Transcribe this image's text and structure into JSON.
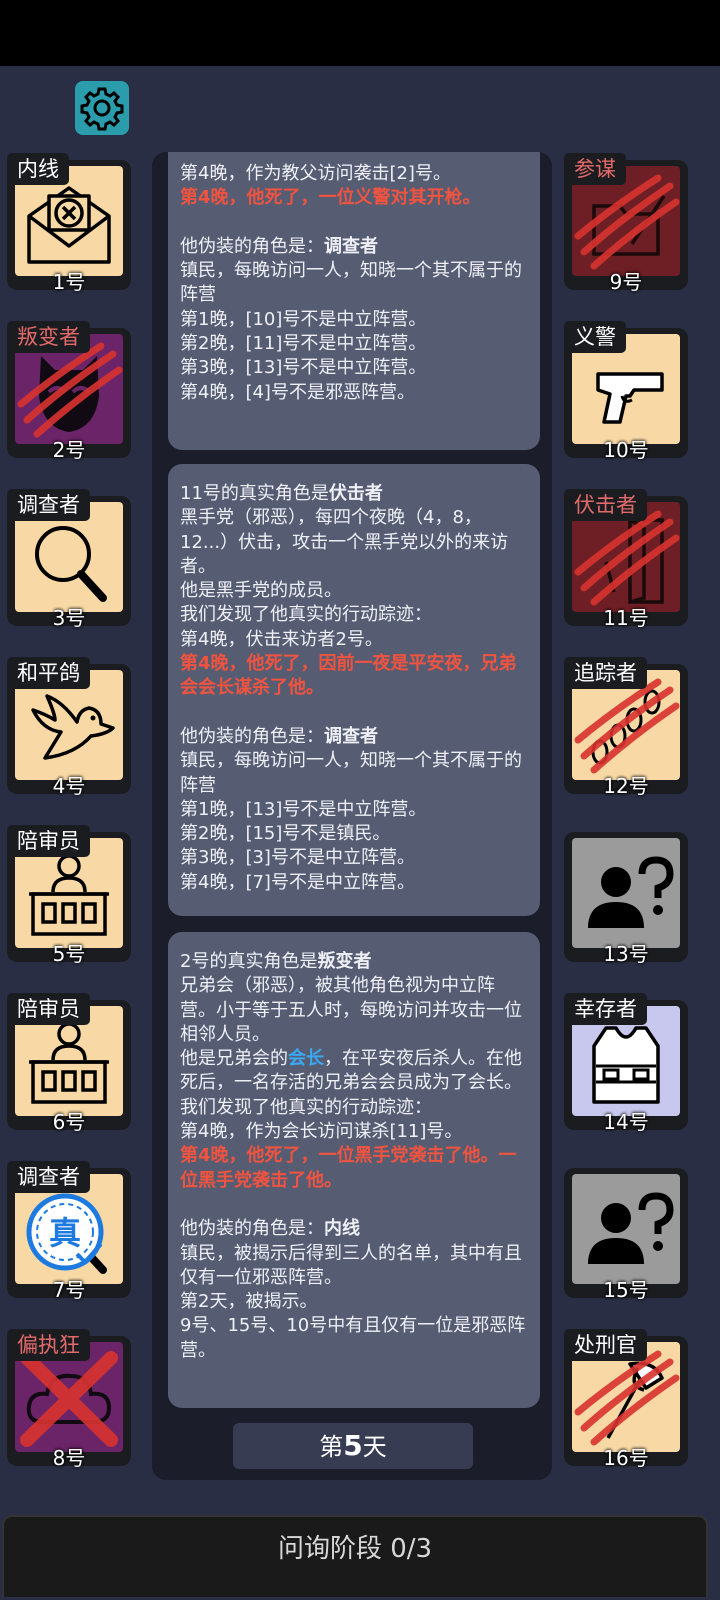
{
  "icons": {
    "settings": "gear-icon"
  },
  "players_left": [
    {
      "role": "内线",
      "num": "1号",
      "red": false,
      "face": "cream",
      "icon": "envelope-x-icon",
      "clawed": false
    },
    {
      "role": "叛变者",
      "num": "2号",
      "red": true,
      "face": "purple",
      "icon": "cat-mask-icon",
      "clawed": true
    },
    {
      "role": "调查者",
      "num": "3号",
      "red": false,
      "face": "cream",
      "icon": "magnifier-icon",
      "clawed": false
    },
    {
      "role": "和平鸽",
      "num": "4号",
      "red": false,
      "face": "cream",
      "icon": "dove-icon",
      "clawed": false
    },
    {
      "role": "陪审员",
      "num": "5号",
      "red": false,
      "face": "cream",
      "icon": "juror-icon",
      "clawed": false
    },
    {
      "role": "陪审员",
      "num": "6号",
      "red": false,
      "face": "cream",
      "icon": "juror-icon",
      "clawed": false
    },
    {
      "role": "调查者",
      "num": "7号",
      "red": false,
      "face": "cream",
      "icon": "true-seal-icon",
      "clawed": false,
      "seal_text": "真"
    },
    {
      "role": "偏执狂",
      "num": "8号",
      "red": true,
      "face": "purple",
      "icon": "crossed-out-icon",
      "clawed": false
    }
  ],
  "players_right": [
    {
      "role": "参谋",
      "num": "9号",
      "red": true,
      "face": "maroon",
      "icon": "folder-pen-icon",
      "clawed": true
    },
    {
      "role": "义警",
      "num": "10号",
      "red": false,
      "face": "cream",
      "icon": "pistol-icon",
      "clawed": false
    },
    {
      "role": "伏击者",
      "num": "11号",
      "red": true,
      "face": "maroon",
      "icon": "door-knife-icon",
      "clawed": true
    },
    {
      "role": "追踪者",
      "num": "12号",
      "red": false,
      "face": "cream",
      "icon": "footprints-icon",
      "clawed": true
    },
    {
      "role": "",
      "num": "13号",
      "red": false,
      "face": "grey",
      "icon": "unknown-person-icon",
      "clawed": false
    },
    {
      "role": "幸存者",
      "num": "14号",
      "red": false,
      "face": "lav",
      "icon": "vest-icon",
      "clawed": false
    },
    {
      "role": "",
      "num": "15号",
      "red": false,
      "face": "grey",
      "icon": "unknown-person-icon",
      "clawed": false
    },
    {
      "role": "处刑官",
      "num": "16号",
      "red": false,
      "face": "cream",
      "icon": "axe-icon",
      "clawed": true
    }
  ],
  "messages": {
    "m1": {
      "l1": "第4晚，作为教父访问袭击[2]号。",
      "l2": "第4晚，他死了，一位义警对其开枪。",
      "l3": "他伪装的角色是：",
      "l3b": "调查者",
      "l4": "镇民，每晚访问一人，知晓一个其不属于的阵营",
      "l5": "第1晚，[10]号不是中立阵营。",
      "l6": "第2晚，[11]号不是中立阵营。",
      "l7": "第3晚，[13]号不是中立阵营。",
      "l8": "第4晚，[4]号不是邪恶阵营。"
    },
    "m2": {
      "l1": "11号的真实角色是",
      "l1b": "伏击者",
      "l2": "黑手党（邪恶），每四个夜晚（4，8，12...）伏击，攻击一个黑手党以外的来访者。",
      "l3": "他是黑手党的成员。",
      "l4": "我们发现了他真实的行动踪迹：",
      "l5": "第4晚，伏击来访者2号。",
      "l6": "第4晚，他死了，因前一夜是平安夜，兄弟会会长谋杀了他。",
      "l7": "他伪装的角色是：",
      "l7b": "调查者",
      "l8": "镇民，每晚访问一人，知晓一个其不属于的阵营",
      "l9": "第1晚，[13]号不是中立阵营。",
      "l10": "第2晚，[15]号不是镇民。",
      "l11": "第3晚，[3]号不是中立阵营。",
      "l12": "第4晚，[7]号不是中立阵营。"
    },
    "m3": {
      "l1": "2号的真实角色是",
      "l1b": "叛变者",
      "l2": "兄弟会（邪恶），被其他角色视为中立阵营。小于等于五人时，每晚访问并攻击一位相邻人员。",
      "l3": "他是兄弟会的",
      "l3b": "会长",
      "l3c": "，在平安夜后杀人。在他死后，一名存活的兄弟会会员成为了会长。",
      "l4": "我们发现了他真实的行动踪迹：",
      "l5": "第4晚，作为会长访问谋杀[11]号。",
      "l6": "第4晚，他死了，一位黑手党袭击了他。一位黑手党袭击了他。",
      "l7": "他伪装的角色是：",
      "l7b": "内线",
      "l8": "镇民，被揭示后得到三人的名单，其中有且仅有一位邪恶阵营。",
      "l9": "第2天，被揭示。",
      "l10": "9号、15号、10号中有且仅有一位是邪恶阵营。"
    }
  },
  "day": {
    "prefix": "第",
    "number": "5",
    "suffix": "天"
  },
  "phase": "问询阶段 0/3",
  "colors": {
    "teal": "#2a9cab",
    "cream": "#f8d9a6",
    "maroon": "#6e1f25",
    "purple": "#6a2467",
    "red_text": "#f0533f",
    "blue_text": "#3ba8f0"
  }
}
